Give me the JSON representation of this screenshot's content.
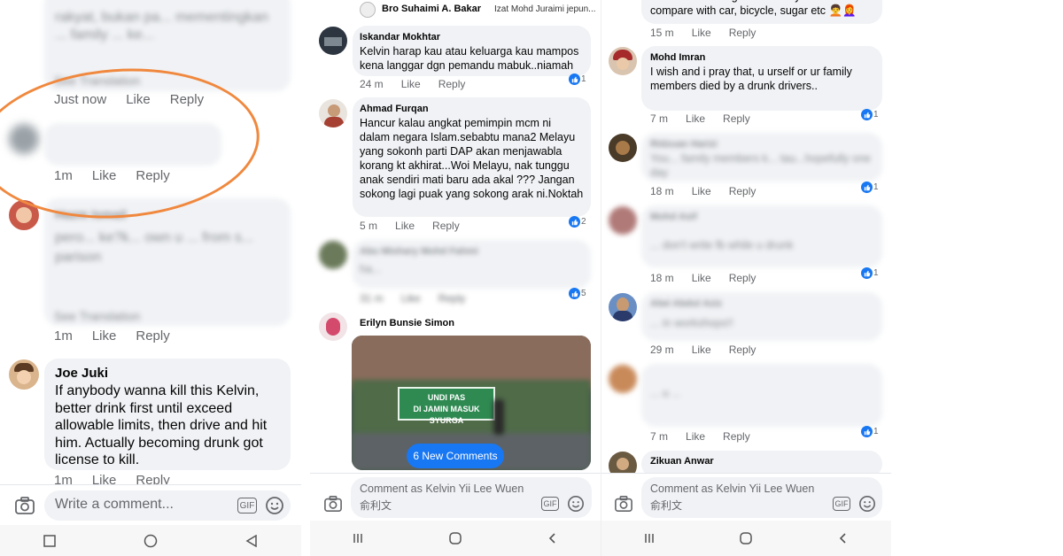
{
  "panel1": {
    "blurred_top_text": "rakyat, bukan pa... mementingkan ... family ... ke...",
    "see_translation_1": "See Translation",
    "c1_time": "Just now",
    "like": "Like",
    "reply": "Reply",
    "c2_time": "1m",
    "c3_blurred_author": "Hazm Ismail",
    "c3_blurred_text": "pero... ke?k... own u ... from s... parison",
    "see_translation_2": "See Translation",
    "c3_time": "1m",
    "c4_author": "Joe Juki",
    "c4_text": "If anybody wanna kill this Kelvin, better drink first until exceed allowable limits, then drive and hit him. Actually becoming drunk got license to kill.",
    "c4_time": "1m",
    "composer_placeholder": "Write a comment...",
    "gif_label": "GIF"
  },
  "panel2": {
    "header_author": "Bro Suhaimi A. Bakar",
    "header_sub": "Izat Mohd Juraimi jepun...",
    "c1_author": "Iskandar Mokhtar",
    "c1_text": "Kelvin harap kau atau keluarga kau mampos kena langgar dgn pemandu mabuk..niamah",
    "c1_time": "24 m",
    "c1_reactions": "1",
    "c2_author": "Ahmad Furqan",
    "c2_text": "Hancur kalau angkat pemimpin mcm ni dalam negara Islam.sebabtu mana2 Melayu yang sokonh parti DAP akan menjawabla korang kt akhirat...Woi Melayu, nak tunggu anak sendiri mati baru ada akal ??? Jangan sokong lagi puak yang sokong arak ni.Noktah",
    "c2_time": "5 m",
    "c2_reactions": "2",
    "c3_blurred_author": "Abu Mishary Mohd Fahmi",
    "c3_blurred_text": "ha...",
    "c3_time": "31 m",
    "c3_reactions": "5",
    "c4_author": "Erilyn Bunsie Simon",
    "video_sign_line1": "UNDI PAS",
    "video_sign_line2": "DI JAMIN MASUK SYURGA",
    "new_comments": "6 New Comments",
    "composer_placeholder": "Comment as Kelvin Yii Lee Wuen",
    "composer_sub": "俞利文",
    "gif_label": "GIF",
    "like": "Like",
    "reply": "Reply"
  },
  "panel3": {
    "c0_text": "Alcohol is never good and why need to compare with car, bicycle, sugar etc 🧑‍🦱👩‍🦰",
    "c0_time": "15 m",
    "c1_author": "Mohd Imran",
    "c1_text": "I wish and i pray that, u urself or ur family members died by a drunk drivers..",
    "c1_time": "7 m",
    "c1_reactions": "1",
    "c2_blurred_author": "Ridzuan Harizi",
    "c2_blurred_text": "You... family members k... tau...hopefully one day",
    "c2_time": "18 m",
    "c2_reactions": "1",
    "c3_blurred_author": "Mohd Asif",
    "c3_blurred_text": "... don't write fb while u drunk",
    "c3_time": "18 m",
    "c3_reactions": "1",
    "c4_blurred_author": "Alwi Abdul Aziz",
    "c4_blurred_text": "... in workshops!!",
    "c4_time": "29 m",
    "c5_blurred_text": "... u ...",
    "c5_time": "7 m",
    "c5_reactions": "1",
    "c6_author": "Zikuan Anwar",
    "composer_placeholder": "Comment as Kelvin Yii Lee Wuen",
    "composer_sub": "俞利文",
    "gif_label": "GIF",
    "like": "Like",
    "reply": "Reply"
  },
  "colors": {
    "bubble": "#f0f2f5",
    "facebook_blue": "#1877f2",
    "meta_text": "#65676b",
    "annotation_circle": "#f0883e"
  }
}
